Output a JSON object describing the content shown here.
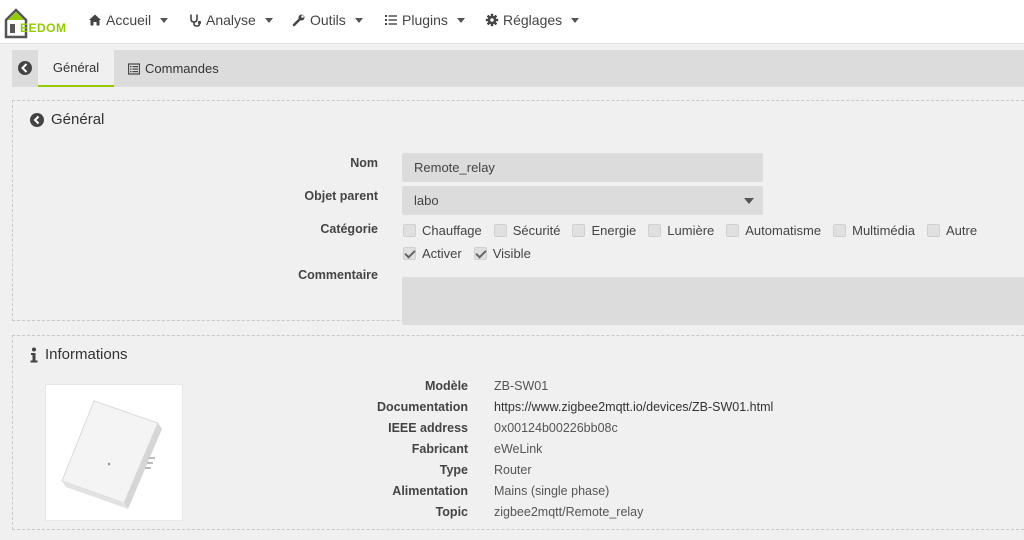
{
  "navbar": {
    "logo_text": "EEDOM",
    "items": [
      {
        "label": "Accueil",
        "icon": "home-icon"
      },
      {
        "label": "Analyse",
        "icon": "stethoscope-icon"
      },
      {
        "label": "Outils",
        "icon": "wrench-icon"
      },
      {
        "label": "Plugins",
        "icon": "list-icon"
      },
      {
        "label": "Réglages",
        "icon": "cog-icon"
      }
    ]
  },
  "tabs": {
    "back_icon": "arrow-circle-left-icon",
    "items": [
      {
        "label": "Général",
        "active": true
      },
      {
        "label": "Commandes",
        "icon": "list-alt-icon",
        "active": false
      }
    ]
  },
  "general": {
    "title": "Général",
    "title_icon": "arrow-circle-left-icon",
    "nom_label": "Nom",
    "nom_value": "Remote_relay",
    "parent_label": "Objet parent",
    "parent_value": "labo",
    "categorie_label": "Catégorie",
    "categories": [
      {
        "label": "Chauffage",
        "checked": false
      },
      {
        "label": "Sécurité",
        "checked": false
      },
      {
        "label": "Energie",
        "checked": false
      },
      {
        "label": "Lumière",
        "checked": false
      },
      {
        "label": "Automatisme",
        "checked": false
      },
      {
        "label": "Multimédia",
        "checked": false
      },
      {
        "label": "Autre",
        "checked": false
      }
    ],
    "flags": [
      {
        "label": "Activer",
        "checked": true
      },
      {
        "label": "Visible",
        "checked": true
      }
    ],
    "commentaire_label": "Commentaire",
    "commentaire_value": ""
  },
  "informations": {
    "title": "Informations",
    "title_icon": "info-icon",
    "rows": [
      {
        "label": "Modèle",
        "value": "ZB-SW01"
      },
      {
        "label": "Documentation",
        "value": "https://www.zigbee2mqtt.io/devices/ZB-SW01.html"
      },
      {
        "label": "IEEE address",
        "value": "0x00124b00226bb08c"
      },
      {
        "label": "Fabricant",
        "value": "eWeLink"
      },
      {
        "label": "Type",
        "value": "Router"
      },
      {
        "label": "Alimentation",
        "value": "Mains (single phase)"
      },
      {
        "label": "Topic",
        "value": "zigbee2mqtt/Remote_relay"
      }
    ]
  },
  "colors": {
    "accent": "#94ca02",
    "input_bg": "#dcdcdc",
    "page_bg": "#f0f0f0"
  }
}
